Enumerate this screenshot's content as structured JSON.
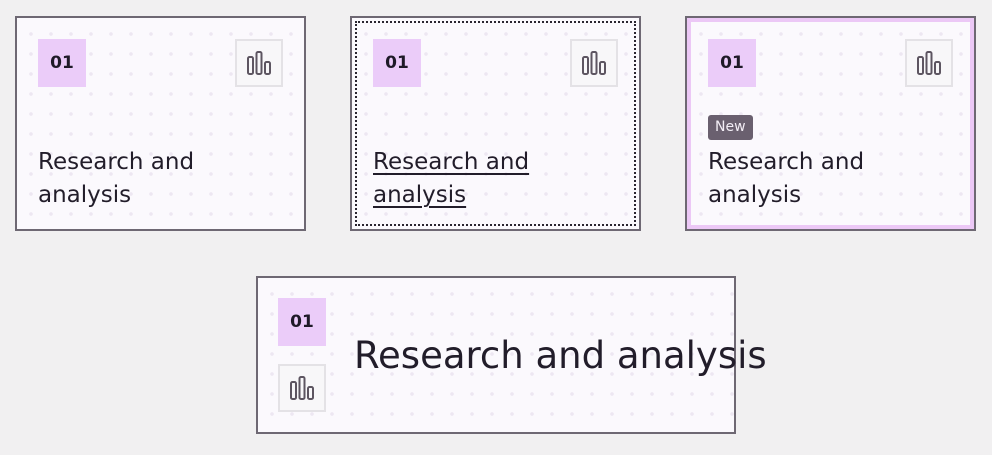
{
  "cards": [
    {
      "variant": "default",
      "number": "01",
      "title": "Research and analysis",
      "icon": "bar-chart-icon"
    },
    {
      "variant": "focused",
      "number": "01",
      "title": "Research and analysis",
      "icon": "bar-chart-icon"
    },
    {
      "variant": "new",
      "number": "01",
      "badge": "New",
      "title": "Research and analysis",
      "icon": "bar-chart-icon"
    },
    {
      "variant": "wide",
      "number": "01",
      "title": "Research and analysis",
      "icon": "bar-chart-icon"
    }
  ],
  "colors": {
    "page_background": "#f1f0f1",
    "card_background": "#fbf9fd",
    "card_border": "#6e6873",
    "number_badge": "#ebccf9",
    "new_badge": "#6a606f",
    "new_card_highlight": "#ecc8f6",
    "text": "#221d2a",
    "icon": "#5d5561"
  }
}
